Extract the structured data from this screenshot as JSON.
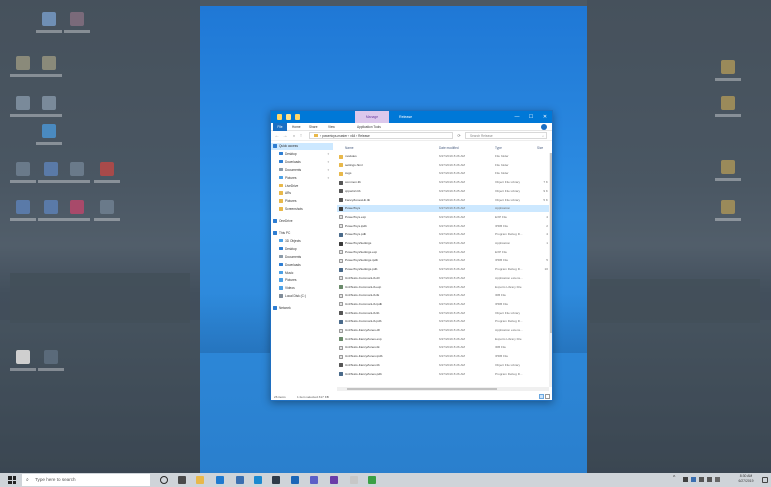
{
  "window": {
    "manage_tab": "Manage",
    "title": "Release",
    "controls": {
      "minimize": "—",
      "maximize": "☐",
      "close": "✕"
    }
  },
  "ribbon": {
    "tabs": [
      "File",
      "Home",
      "Share",
      "View",
      "Application Tools"
    ]
  },
  "address": {
    "back": "←",
    "forward": "→",
    "up": "↑",
    "path": "› powertoys-master › x64 › Release",
    "refresh": "⟳",
    "search_placeholder": "Search Release",
    "search_icon": "⌕"
  },
  "nav": {
    "items": [
      {
        "label": "Quick access",
        "icon_color": "#2d7dd2",
        "pinned": false
      },
      {
        "label": "Desktop",
        "icon_color": "#2d7dd2",
        "pinned": true
      },
      {
        "label": "Downloads",
        "icon_color": "#2d7dd2",
        "pinned": true
      },
      {
        "label": "Documents",
        "icon_color": "#8a9aa8",
        "pinned": true
      },
      {
        "label": "Pictures",
        "icon_color": "#4aa0e6",
        "pinned": true
      },
      {
        "label": "LiveDrive",
        "icon_color": "#e8b84a",
        "pinned": false
      },
      {
        "label": "ARs",
        "icon_color": "#e8b84a",
        "pinned": false
      },
      {
        "label": "Pictures",
        "icon_color": "#e8b84a",
        "pinned": false
      },
      {
        "label": "Screenshots",
        "icon_color": "#e8b84a",
        "pinned": false
      },
      {
        "label": "OneDrive",
        "icon_color": "#2d7dd2",
        "pinned": false
      },
      {
        "label": "This PC",
        "icon_color": "#2d7dd2",
        "pinned": false
      },
      {
        "label": "3D Objects",
        "icon_color": "#4aa0e6",
        "pinned": false
      },
      {
        "label": "Desktop",
        "icon_color": "#2d7dd2",
        "pinned": false
      },
      {
        "label": "Documents",
        "icon_color": "#8a9aa8",
        "pinned": false
      },
      {
        "label": "Downloads",
        "icon_color": "#2d7dd2",
        "pinned": false
      },
      {
        "label": "Music",
        "icon_color": "#4aa0e6",
        "pinned": false
      },
      {
        "label": "Pictures",
        "icon_color": "#4aa0e6",
        "pinned": false
      },
      {
        "label": "Videos",
        "icon_color": "#4aa0e6",
        "pinned": false
      },
      {
        "label": "Local Disk (C:)",
        "icon_color": "#7f8c99",
        "pinned": false
      },
      {
        "label": "Network",
        "icon_color": "#2d7dd2",
        "pinned": false
      }
    ],
    "pin_glyph": "✦"
  },
  "columns": {
    "name": "Name",
    "date": "Date modified",
    "type": "Type",
    "size": "Size"
  },
  "files": [
    {
      "name": "modules",
      "date": "6/27/2019 8:26 AM",
      "type": "File folder",
      "size": "",
      "color": "#e8b84a",
      "selected": false
    },
    {
      "name": "settings-html",
      "date": "6/27/2019 8:26 AM",
      "type": "File folder",
      "size": "",
      "color": "#e8b84a",
      "selected": false
    },
    {
      "name": "svgs",
      "date": "6/27/2019 8:26 AM",
      "type": "File folder",
      "size": "",
      "color": "#e8b84a",
      "selected": false
    },
    {
      "name": "common.lib",
      "date": "6/27/2019 8:25 AM",
      "type": "Object File Library",
      "size": "7 K",
      "color": "#555555",
      "selected": false
    },
    {
      "name": "cppwinrt.lib",
      "date": "6/27/2019 8:25 AM",
      "type": "Object File Library",
      "size": "9 K",
      "color": "#555555",
      "selected": false
    },
    {
      "name": "FancyZonesLib.lib",
      "date": "6/27/2019 8:26 AM",
      "type": "Object File Library",
      "size": "5 K",
      "color": "#555555",
      "selected": false
    },
    {
      "name": "PowerToys",
      "date": "6/27/2019 8:26 AM",
      "type": "Application",
      "size": "",
      "color": "#3a3a3a",
      "selected": true
    },
    {
      "name": "PowerToys.exp",
      "date": "6/27/2019 8:26 AM",
      "type": "EXP File",
      "size": "4",
      "color": "#e4e4e4",
      "selected": false
    },
    {
      "name": "PowerToys.ipdb",
      "date": "6/27/2019 8:26 AM",
      "type": "IPDB File",
      "size": "2",
      "color": "#e4e4e4",
      "selected": false
    },
    {
      "name": "PowerToys.pdb",
      "date": "6/27/2019 8:26 AM",
      "type": "Program Debug D...",
      "size": "4",
      "color": "#4a6a8a",
      "selected": false
    },
    {
      "name": "PowerToysSettings",
      "date": "6/27/2019 8:26 AM",
      "type": "Application",
      "size": "1",
      "color": "#3a3a3a",
      "selected": false
    },
    {
      "name": "PowerToysSettings.exp",
      "date": "6/27/2019 8:26 AM",
      "type": "EXP File",
      "size": "",
      "color": "#e4e4e4",
      "selected": false
    },
    {
      "name": "PowerToysSettings.ipdb",
      "date": "6/27/2019 8:26 AM",
      "type": "IPDB File",
      "size": "5",
      "color": "#e4e4e4",
      "selected": false
    },
    {
      "name": "PowerToysSettings.pdb",
      "date": "6/27/2019 8:26 AM",
      "type": "Program Debug D...",
      "size": "10",
      "color": "#4a6a8a",
      "selected": false
    },
    {
      "name": "UnitTests-CommonLib.dll",
      "date": "6/27/2019 8:25 AM",
      "type": "Application extens...",
      "size": "",
      "color": "#e4e4e4",
      "selected": false
    },
    {
      "name": "UnitTests-CommonLib.exp",
      "date": "6/27/2019 8:25 AM",
      "type": "Exports Library File",
      "size": "",
      "color": "#6a8a6a",
      "selected": false
    },
    {
      "name": "UnitTests-CommonLib.ilk",
      "date": "6/27/2019 8:25 AM",
      "type": "IDB File",
      "size": "",
      "color": "#e4e4e4",
      "selected": false
    },
    {
      "name": "UnitTests-CommonLib.ipdb",
      "date": "6/27/2019 8:25 AM",
      "type": "IPDB File",
      "size": "",
      "color": "#e4e4e4",
      "selected": false
    },
    {
      "name": "UnitTests-CommonLib.lib",
      "date": "6/27/2019 8:25 AM",
      "type": "Object File Library",
      "size": "",
      "color": "#555555",
      "selected": false
    },
    {
      "name": "UnitTests-CommonLib.pdb",
      "date": "6/27/2019 8:25 AM",
      "type": "Program Debug D...",
      "size": "",
      "color": "#4a6a8a",
      "selected": false
    },
    {
      "name": "UnitTests-FancyZones.dll",
      "date": "6/27/2019 8:26 AM",
      "type": "Application extens...",
      "size": "",
      "color": "#e4e4e4",
      "selected": false
    },
    {
      "name": "UnitTests-FancyZones.exp",
      "date": "6/27/2019 8:26 AM",
      "type": "Exports Library File",
      "size": "",
      "color": "#6a8a6a",
      "selected": false
    },
    {
      "name": "UnitTests-FancyZones.ilk",
      "date": "6/27/2019 8:26 AM",
      "type": "IDB File",
      "size": "",
      "color": "#e4e4e4",
      "selected": false
    },
    {
      "name": "UnitTests-FancyZones.ipdb",
      "date": "6/27/2019 8:26 AM",
      "type": "IPDB File",
      "size": "",
      "color": "#e4e4e4",
      "selected": false
    },
    {
      "name": "UnitTests-FancyZones.lib",
      "date": "6/27/2019 8:26 AM",
      "type": "Object File Library",
      "size": "",
      "color": "#555555",
      "selected": false
    },
    {
      "name": "UnitTests-FancyZones.pdb",
      "date": "6/27/2019 8:26 AM",
      "type": "Program Debug D...",
      "size": "",
      "color": "#4a6a8a",
      "selected": false
    }
  ],
  "status": {
    "count": "26 items",
    "selected": "1 item selected 317 KB"
  },
  "taskbar": {
    "search_placeholder": "Type here to search",
    "search_icon": "⌕",
    "apps": [
      {
        "name": "cortana-icon",
        "color": "#2a2a2a"
      },
      {
        "name": "task-view-icon",
        "color": "#4a4a4a"
      },
      {
        "name": "file-explorer-icon",
        "color": "#e8b84a"
      },
      {
        "name": "edge-icon",
        "color": "#1f7ad0"
      },
      {
        "name": "store-icon",
        "color": "#3a6fb0"
      },
      {
        "name": "vscode-icon",
        "color": "#1b89d0"
      },
      {
        "name": "terminal-icon",
        "color": "#2f3a48"
      },
      {
        "name": "outlook-icon",
        "color": "#1a66b8"
      },
      {
        "name": "teams-icon",
        "color": "#5b5fc7"
      },
      {
        "name": "visual-studio-icon",
        "color": "#6a3ca8"
      },
      {
        "name": "paint-icon",
        "color": "#c7c7c7"
      },
      {
        "name": "photos-icon",
        "color": "#3aa045"
      }
    ],
    "tray_chevron": "^",
    "clock_time": "8:30 AM",
    "clock_date": "6/27/2019"
  }
}
